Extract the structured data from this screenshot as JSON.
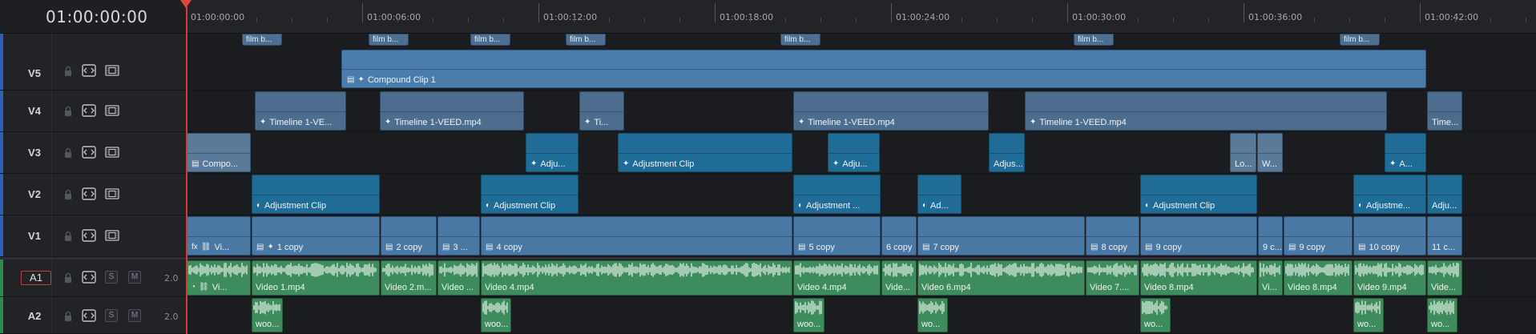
{
  "timecode": "01:00:00:00",
  "ruler": [
    {
      "t": "01:00:00:00"
    },
    {
      "t": "01:00:06:00"
    },
    {
      "t": "01:00:12:00"
    },
    {
      "t": "01:00:18:00"
    },
    {
      "t": "01:00:24:00"
    },
    {
      "t": "01:00:30:00"
    },
    {
      "t": "01:00:36:00"
    },
    {
      "t": "01:00:42:00"
    }
  ],
  "tracks": {
    "v5": "V5",
    "v4": "V4",
    "v3": "V3",
    "v2": "V2",
    "v1": "V1",
    "a1": "A1",
    "a2": "A2"
  },
  "audio_controls": {
    "solo": "S",
    "mute": "M",
    "a1_volume": "2.0",
    "a2_volume": "2.0"
  },
  "film_tags": [
    "film b...",
    "film b...",
    "film b...",
    "film b...",
    "film b...",
    "film b...",
    "film b..."
  ],
  "v5_clips": [
    "Compound Clip 1"
  ],
  "v4_clips": [
    "Timeline 1-VE...",
    "Timeline 1-VEED.mp4",
    "Ti...",
    "Timeline 1-VEED.mp4",
    "Timeline 1-VEED.mp4",
    "Time..."
  ],
  "v3_clips": [
    "Compo...",
    "Adju...",
    "Adjustment Clip",
    "Adju...",
    "Adjus...",
    "Lo...",
    "W...",
    "A..."
  ],
  "v2_clips": [
    "Adjustment Clip",
    "Adjustment Clip",
    "Adjustment ...",
    "Ad...",
    "Adjustment Clip",
    "Adjustme...",
    "Adju..."
  ],
  "v1_clips": [
    "Vi...",
    "1 copy",
    "2 copy",
    "3 ...",
    "4 copy",
    "5 copy",
    "6 copy",
    "7 copy",
    "8 copy",
    "9 copy",
    "9 c...",
    "9 copy",
    "10 copy",
    "11 c..."
  ],
  "a1_clips": [
    "Vi...",
    "Video 1.mp4",
    "Video 2.m...",
    "Video ...",
    "Video 4.mp4",
    "Video 4.mp4",
    "Vide...",
    "Video 6.mp4",
    "Video 7....",
    "Video 8.mp4",
    "Vi...",
    "Video 8.mp4",
    "Video 9.mp4",
    "Vide..."
  ],
  "a2_clips": [
    "woo...",
    "woo...",
    "woo...",
    "wo...",
    "wo...",
    "wo...",
    "wo..."
  ],
  "colors": {
    "video_clip": "#4a78a4",
    "adjustment_clip": "#1f6c96",
    "audio_clip": "#3e8c5d",
    "playhead": "#d23c33",
    "track_selected": "#3a6fd8"
  }
}
